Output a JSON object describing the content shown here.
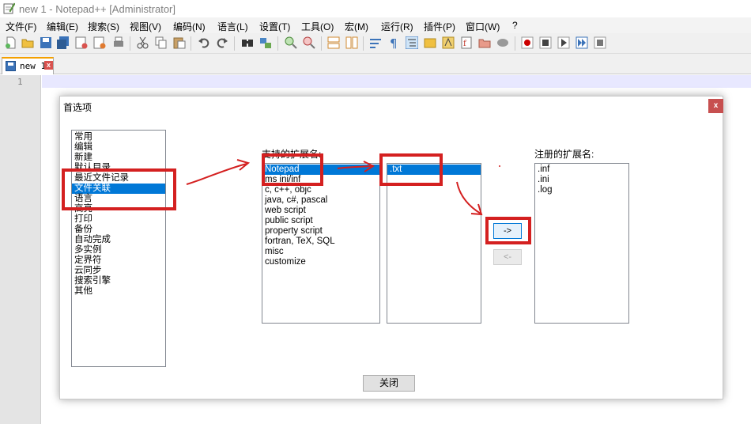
{
  "window": {
    "title": "new 1 - Notepad++ [Administrator]"
  },
  "menu": [
    "文件(F)",
    "编辑(E)",
    "搜索(S)",
    "视图(V)",
    "编码(N)",
    "语言(L)",
    "设置(T)",
    "工具(O)",
    "宏(M)",
    "运行(R)",
    "插件(P)",
    "窗口(W)",
    "?"
  ],
  "tab": {
    "label": "new 1",
    "close_glyph": "x"
  },
  "editor": {
    "line_number": "1"
  },
  "dialog": {
    "title": "首选项",
    "close_glyph": "x",
    "categories": [
      "常用",
      "编辑",
      "新建",
      "默认目录",
      "最近文件记录",
      "文件关联",
      "语言",
      "高亮",
      "打印",
      "备份",
      "自动完成",
      "多实例",
      "定界符",
      "云同步",
      "搜索引擎",
      "其他"
    ],
    "selected_category": "文件关联",
    "supported_label": "支持的扩展名:",
    "supported_groups": [
      "Notepad",
      "ms ini/inf",
      "c, c++, objc",
      "java, c#, pascal",
      "web script",
      "public script",
      "property script",
      "fortran, TeX, SQL",
      "misc",
      "customize"
    ],
    "selected_group": "Notepad",
    "group_extensions": [
      ".txt"
    ],
    "selected_extension": ".txt",
    "registered_label": "注册的扩展名:",
    "registered_extensions": [
      ".inf",
      ".ini",
      ".log"
    ],
    "add_button": "->",
    "remove_button": "<-",
    "close_button": "关闭"
  },
  "colors": {
    "selection": "#0078d7",
    "annotation": "#d42020"
  }
}
